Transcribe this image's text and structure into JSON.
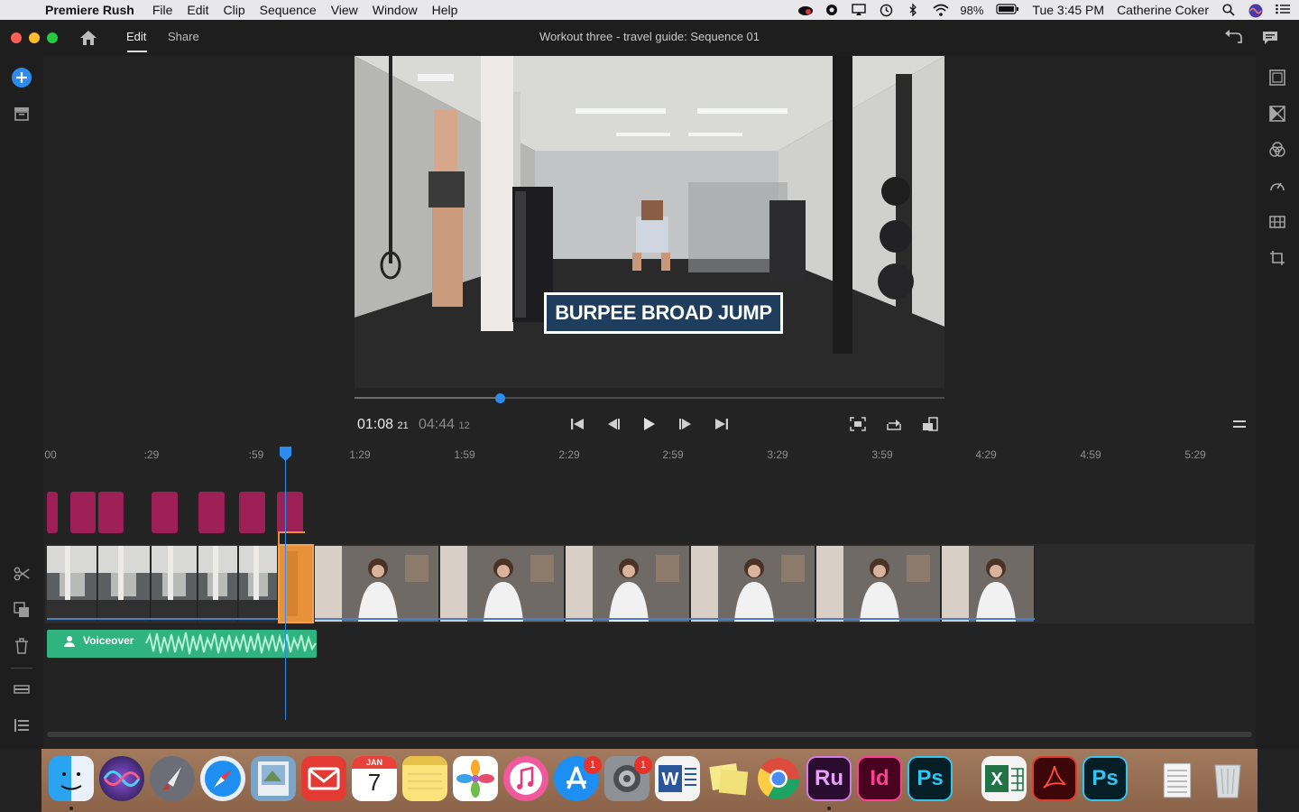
{
  "menubar": {
    "app_name": "Premiere Rush",
    "menus": [
      "File",
      "Edit",
      "Clip",
      "Sequence",
      "View",
      "Window",
      "Help"
    ],
    "battery": "98%",
    "clock": "Tue 3:45 PM",
    "user": "Catherine Coker"
  },
  "header": {
    "tabs": {
      "edit": "Edit",
      "share": "Share"
    },
    "title": "Workout three - travel guide: Sequence 01"
  },
  "preview": {
    "overlay_title": "BURPEE BROAD JUMP",
    "scrub_progress": 0.246
  },
  "transport": {
    "current_time": "01:08",
    "current_frames": "21",
    "total_time": "04:44",
    "total_frames": "12"
  },
  "ruler": {
    "ticks": [
      "00",
      ":29",
      ":59",
      "1:29",
      "1:59",
      "2:29",
      "2:59",
      "3:29",
      "3:59",
      "4:29",
      "4:59",
      "5:29"
    ]
  },
  "timeline": {
    "audio_label": "Voiceover"
  },
  "dock": {
    "calendar_month": "JAN",
    "calendar_day": "7",
    "appstore_badge": "1",
    "settings_badge": "1",
    "rush_label": "Ru",
    "indesign_label": "Id",
    "photoshop_label": "Ps",
    "photoshop2_label": "Ps"
  },
  "colors": {
    "accent_blue": "#2d8ceb",
    "title_clip": "#9c1f56",
    "audio_clip": "#2fb380",
    "selected_clip": "#e8913a"
  }
}
